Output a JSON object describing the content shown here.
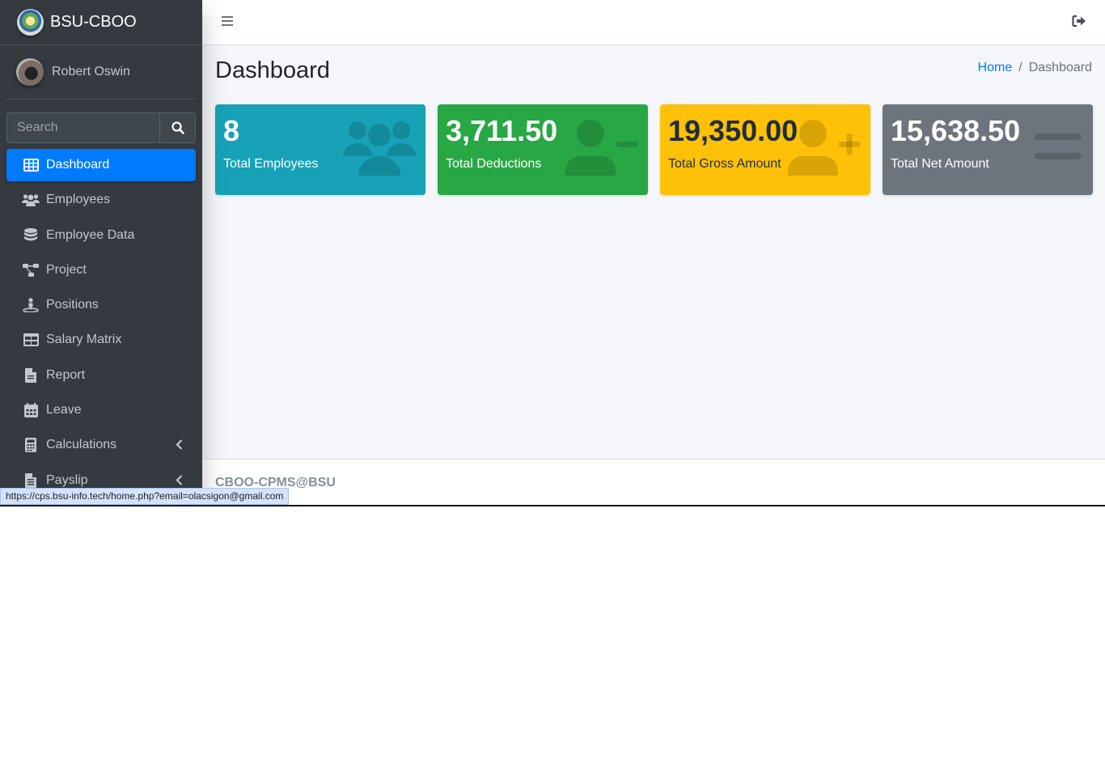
{
  "brand": {
    "name": "BSU-CBOO"
  },
  "user": {
    "name": "Robert Oswin"
  },
  "search": {
    "placeholder": "Search"
  },
  "nav": {
    "items": [
      {
        "label": "Dashboard",
        "icon": "table-icon",
        "active": true
      },
      {
        "label": "Employees",
        "icon": "users-icon"
      },
      {
        "label": "Employee Data",
        "icon": "database-icon"
      },
      {
        "label": "Project",
        "icon": "project-diagram-icon"
      },
      {
        "label": "Positions",
        "icon": "person-position-icon"
      },
      {
        "label": "Salary Matrix",
        "icon": "grid-table-icon"
      },
      {
        "label": "Report",
        "icon": "file-icon"
      },
      {
        "label": "Leave",
        "icon": "calendar-icon"
      },
      {
        "label": "Calculations",
        "icon": "calculator-icon",
        "has_submenu": true
      },
      {
        "label": "Payslip",
        "icon": "file-invoice-icon",
        "has_submenu": true
      }
    ]
  },
  "header": {
    "title": "Dashboard"
  },
  "breadcrumb": {
    "home": "Home",
    "separator": "/",
    "current": "Dashboard"
  },
  "stats": [
    {
      "value": "8",
      "label": "Total Employees",
      "color": "#17a2b8",
      "icon": "users-icon"
    },
    {
      "value": "3,711.50",
      "label": "Total Deductions",
      "color": "#28a745",
      "icon": "user-minus-icon"
    },
    {
      "value": "19,350.00",
      "label": "Total Gross Amount",
      "color": "#ffc107",
      "icon": "user-plus-icon"
    },
    {
      "value": "15,638.50",
      "label": "Total Net Amount",
      "color": "#6c757d",
      "icon": "equals-icon"
    }
  ],
  "footer": {
    "text": "CBOO-CPMS@BSU"
  },
  "status_bar": {
    "url": "https://cps.bsu-info.tech/home.php?email=olacsigon@gmail.com"
  },
  "colors": {
    "primary": "#007bff",
    "sidebar": "#343a40",
    "content_bg": "#f4f6f9"
  }
}
